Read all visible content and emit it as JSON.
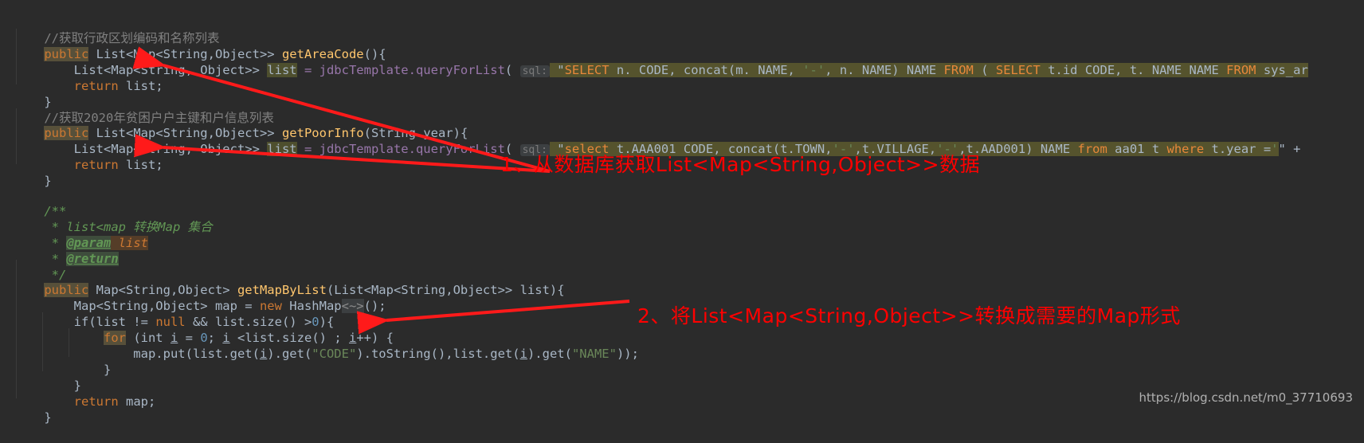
{
  "editor": {
    "theme_background": "#2b2b2b",
    "default_text_color": "#a9b7c6",
    "lines": {
      "l1_comment": "//获取行政区划编码和名称列表",
      "l2_public": "public",
      "l2_sig": " List<Map<String,Object>> ",
      "l2_name": "getAreaCode",
      "l2_tail": "(){",
      "l3_a": "    List<Map<String, Object>> ",
      "l3_var": "list",
      "l3_b": " = jdbcTemplate.",
      "l3_call": "queryForList",
      "l3_c": "( ",
      "l3_hint": "sql:",
      "l3_quote": " \"",
      "l4_return": "    return",
      "l4_rest": " list;",
      "l5_brace": "}",
      "l6_comment": "//获取2020年贫困户户主键和户信息列表",
      "l7_public": "public",
      "l7_sig": " List<Map<String,Object>> ",
      "l7_name": "getPoorInfo",
      "l7_tail": "(String year){",
      "l8_a": "    List<Map<String, Object>> ",
      "l8_var": "list",
      "l8_b": " = jdbcTemplate.",
      "l8_call": "queryForList",
      "l8_c": "( ",
      "l8_hint": "sql:",
      "l8_quote": " \"",
      "l9_return": "    return",
      "l9_rest": " list;",
      "l10_brace": "}",
      "l12_jdoc_open": "/**",
      "l13_jdoc": " * list<map 转换Map 集合",
      "l14_star": " * ",
      "l14_tag": "@param",
      "l14_param": " list",
      "l15_star": " * ",
      "l15_tag": "@return",
      "l16_jdoc_close": " */",
      "l17_public": "public",
      "l17_sig": " Map<String,Object> ",
      "l17_name": "getMapByList",
      "l17_tail": "(List<Map<String,Object>> list){",
      "l18_a": "    Map<String,Object> map = ",
      "l18_new": "new",
      "l18_b": " HashMap",
      "l18_diamond": "<~>",
      "l18_c": "();",
      "l19": "    if(list != ",
      "l19_null": "null",
      "l19_b": " && list.size() >",
      "l19_num": "0",
      "l19_c": "){",
      "l20_indent": "        ",
      "l20_for": "for",
      "l20_a": " (int ",
      "l20_i1": "i",
      "l20_b": " = ",
      "l20_zero": "0",
      "l20_c": "; ",
      "l20_i2": "i",
      "l20_d": " <list.size() ; ",
      "l20_i3": "i",
      "l20_e": "++) {",
      "l21_a": "            map.put(list.get(",
      "l21_i1": "i",
      "l21_b": ").get(",
      "l21_s1": "\"CODE\"",
      "l21_c": ").toString(),list.get(",
      "l21_i2": "i",
      "l21_d": ").get(",
      "l21_s2": "\"NAME\"",
      "l21_e": "));",
      "l22_brace": "        }",
      "l23_brace": "    }",
      "l24_return": "    return",
      "l24_rest": " map;",
      "l25_brace": "}"
    },
    "sql1": {
      "parts": [
        {
          "t": "SELECT",
          "c": "kw"
        },
        {
          "t": " n. CODE, concat(m. NAME, ",
          "c": "id"
        },
        {
          "t": "'-'",
          "c": "str"
        },
        {
          "t": ", n. NAME) NAME ",
          "c": "id"
        },
        {
          "t": "FROM",
          "c": "kw"
        },
        {
          "t": " ( ",
          "c": "id"
        },
        {
          "t": "SELECT",
          "c": "kw"
        },
        {
          "t": " t.id CODE, t. NAME NAME ",
          "c": "id"
        },
        {
          "t": "FROM",
          "c": "kw"
        },
        {
          "t": " sys_ar",
          "c": "id"
        }
      ]
    },
    "sql2": {
      "parts": [
        {
          "t": "select",
          "c": "kw"
        },
        {
          "t": " t.AAA001 CODE, concat(t.TOWN,",
          "c": "id"
        },
        {
          "t": "'-'",
          "c": "str"
        },
        {
          "t": ",t.VILLAGE,",
          "c": "id"
        },
        {
          "t": "'-'",
          "c": "str"
        },
        {
          "t": ",t.AAD001) NAME ",
          "c": "id"
        },
        {
          "t": "from",
          "c": "kw"
        },
        {
          "t": " aa01 t ",
          "c": "id"
        },
        {
          "t": "where",
          "c": "kw"
        },
        {
          "t": " t.year =",
          "c": "id"
        },
        {
          "t": "'",
          "c": "str"
        }
      ],
      "suffix": "\" +"
    }
  },
  "annotations": {
    "color": "#ff0000",
    "items": [
      {
        "label": "1、从数据库获取List<Map<String,Object>>数据"
      },
      {
        "label": "2、将List<Map<String,Object>>转换成需要的Map形式"
      }
    ]
  },
  "watermark": {
    "url": "https://blog.csdn.net/m0_37710693"
  }
}
